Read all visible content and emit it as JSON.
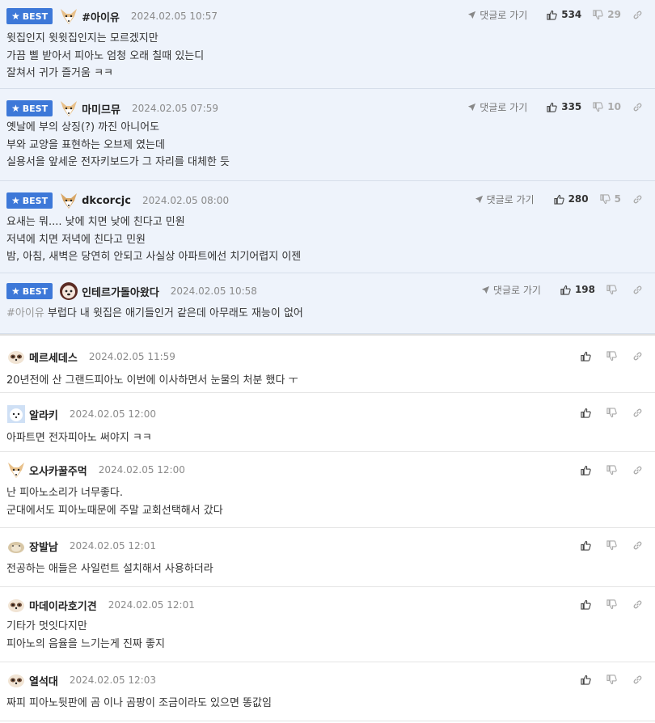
{
  "ui": {
    "best_label": "BEST",
    "reply_label": "댓글로 가기"
  },
  "best_comments": [
    {
      "nick": "#아이유",
      "date": "2024.02.05 10:57",
      "up": "534",
      "down": "29",
      "avatar": "fox-avatar-icon",
      "lines": [
        "윗집인지 윗윗집인지는 모르겠지만",
        "가끔 삘 받아서 피아노 엄청 오래 칠때 있는디",
        "잘쳐서 귀가 즐거움 ㅋㅋ"
      ]
    },
    {
      "nick": "마미므뮤",
      "date": "2024.02.05 07:59",
      "up": "335",
      "down": "10",
      "avatar": "fox-avatar-icon",
      "lines": [
        "옛날에 부의 상징(?) 까진 아니어도",
        "부와 교양을 표현하는 오브제 였는데",
        "실용서을 앞세운 전자키보드가 그 자리를 대체한 듯"
      ]
    },
    {
      "nick": "dkcorcjc",
      "date": "2024.02.05 08:00",
      "up": "280",
      "down": "5",
      "avatar": "fox-avatar-icon",
      "lines": [
        "요새는 뭐.... 낮에 치면 낮에 친다고 민원",
        "저녁에 치면 저녁에 친다고 민원",
        "밤, 아침, 새벽은 당연히 안되고 사실상 아파트에선 치기어렵지 이젠"
      ]
    },
    {
      "nick": "인테르가돌아왔다",
      "date": "2024.02.05 10:58",
      "up": "198",
      "down": "",
      "avatar": "dog-avatar-icon",
      "mention": "#아이유",
      "lines": [
        "부럽다 내 윗집은 애기들인거 같은데 아무래도 재능이 없어"
      ]
    }
  ],
  "comments": [
    {
      "nick": "메르세데스",
      "date": "2024.02.05 11:59",
      "avatar": "ferret-avatar-icon",
      "lines": [
        "20년전에 산 그랜드피아노 이번에 이사하면서 눈물의 처분 했다 ㅜ"
      ]
    },
    {
      "nick": "알라키",
      "date": "2024.02.05 12:00",
      "avatar": "white-dog-avatar-icon",
      "lines": [
        "아파트면 전자피아노 써야지 ㅋㅋ"
      ]
    },
    {
      "nick": "오사카꿀주먹",
      "date": "2024.02.05 12:00",
      "avatar": "fox-avatar-icon",
      "lines": [
        "난 피아노소리가 너무좋다.",
        "군대에서도 피아노때문에 주말 교회선택해서 갔다"
      ]
    },
    {
      "nick": "장발남",
      "date": "2024.02.05 12:01",
      "avatar": "hamster-avatar-icon",
      "lines": [
        "전공하는 애들은 사일런트 설치해서 사용하더라"
      ]
    },
    {
      "nick": "마데이라호기견",
      "date": "2024.02.05 12:01",
      "avatar": "ferret-avatar-icon",
      "lines": [
        "기타가 멋잇다지만",
        "피아노의 음율을 느기는게 진짜 좋지"
      ]
    },
    {
      "nick": "열석대",
      "date": "2024.02.05 12:03",
      "avatar": "ferret-avatar-icon",
      "lines": [
        "짜피 피아노뒷판에 곰 이나 곰팡이 조금이라도 있으면 똥값임"
      ]
    }
  ]
}
